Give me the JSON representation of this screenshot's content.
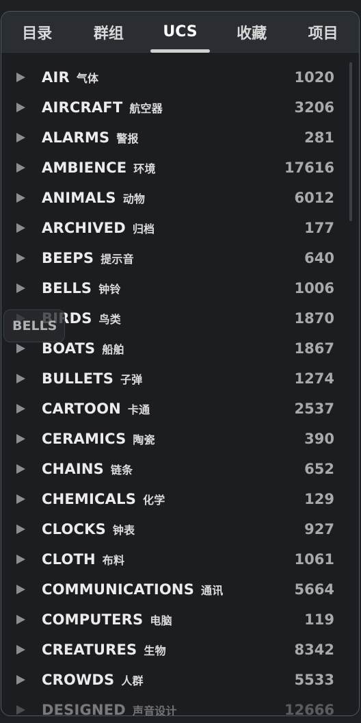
{
  "tabs": [
    {
      "label": "目录"
    },
    {
      "label": "群组"
    },
    {
      "label": "UCS"
    },
    {
      "label": "收藏"
    },
    {
      "label": "项目"
    }
  ],
  "active_tab": "UCS",
  "categories": [
    {
      "name": "AIR",
      "cn": "气体",
      "count": "1020"
    },
    {
      "name": "AIRCRAFT",
      "cn": "航空器",
      "count": "3206"
    },
    {
      "name": "ALARMS",
      "cn": "警报",
      "count": "281"
    },
    {
      "name": "AMBIENCE",
      "cn": "环境",
      "count": "17616"
    },
    {
      "name": "ANIMALS",
      "cn": "动物",
      "count": "6012"
    },
    {
      "name": "ARCHIVED",
      "cn": "归档",
      "count": "177"
    },
    {
      "name": "BEEPS",
      "cn": "提示音",
      "count": "640"
    },
    {
      "name": "BELLS",
      "cn": "钟铃",
      "count": "1006"
    },
    {
      "name": "BIRDS",
      "cn": "鸟类",
      "count": "1870"
    },
    {
      "name": "BOATS",
      "cn": "船舶",
      "count": "1867"
    },
    {
      "name": "BULLETS",
      "cn": "子弹",
      "count": "1274"
    },
    {
      "name": "CARTOON",
      "cn": "卡通",
      "count": "2537"
    },
    {
      "name": "CERAMICS",
      "cn": "陶瓷",
      "count": "390"
    },
    {
      "name": "CHAINS",
      "cn": "链条",
      "count": "652"
    },
    {
      "name": "CHEMICALS",
      "cn": "化学",
      "count": "129"
    },
    {
      "name": "CLOCKS",
      "cn": "钟表",
      "count": "927"
    },
    {
      "name": "CLOTH",
      "cn": "布料",
      "count": "1061"
    },
    {
      "name": "COMMUNICATIONS",
      "cn": "通讯",
      "count": "5664"
    },
    {
      "name": "COMPUTERS",
      "cn": "电脑",
      "count": "119"
    },
    {
      "name": "CREATURES",
      "cn": "生物",
      "count": "8342"
    },
    {
      "name": "CROWDS",
      "cn": "人群",
      "count": "5533"
    },
    {
      "name": "DESIGNED",
      "cn": "声音设计",
      "count": "12666"
    }
  ],
  "drag_tooltip": "BELLS",
  "colors": {
    "background": "#1c1d20",
    "tab_bar": "#2a2e33",
    "border": "#4a5a66",
    "count_text": "#a7a9ac"
  }
}
